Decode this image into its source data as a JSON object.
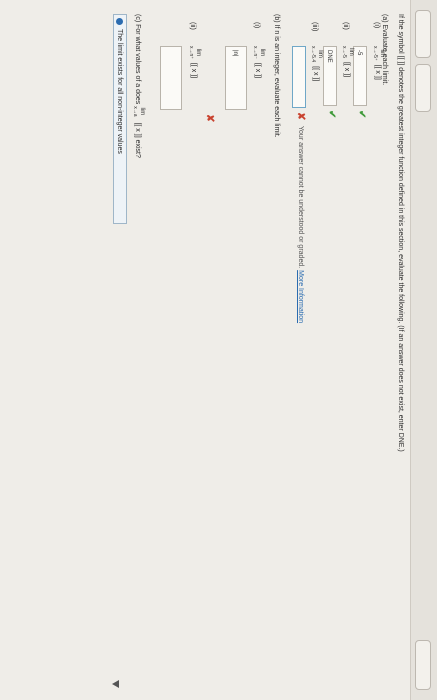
{
  "question": {
    "intro": "If the symbol [[ ]] denotes the greatest integer function defined in this section, evaluate the following. (If an answer does not exist, enter DNE.)"
  },
  "part_a": {
    "label": "(a)",
    "instruction": "Evaluate each limit.",
    "items": [
      {
        "num": "(i)",
        "lim": "lim",
        "under": "x→-5⁺",
        "expr": "[[ x ]]",
        "answer": "-5",
        "status": "correct"
      },
      {
        "num": "(ii)",
        "lim": "lim",
        "under": "x→-5",
        "expr": "[[ x ]]",
        "answer": "DNE",
        "status": "correct"
      },
      {
        "num": "(iii)",
        "lim": "lim",
        "under": "x→-5.4",
        "expr": "[[ x ]]",
        "answer": "",
        "status": "error"
      }
    ],
    "error_msg": "Your answer cannot be understood or graded.",
    "more_info": "More Information"
  },
  "part_b": {
    "label": "(b)",
    "instruction": "If n is an integer, evaluate each limit.",
    "items": [
      {
        "num": "(i)",
        "lim": "lim",
        "under": "x→n⁻",
        "expr": "[[ x ]]",
        "answer": "|n|",
        "status": "incorrect"
      },
      {
        "num": "(ii)",
        "lim": "lim",
        "under": "x→n⁺",
        "expr": "[[ x ]]",
        "answer": "",
        "status": "none"
      }
    ]
  },
  "part_c": {
    "label": "(c)",
    "prompt_pre": "For what values of a does",
    "lim": "lim",
    "under": "x→a",
    "expr": "[[ x ]]",
    "prompt_post": "exist?",
    "selected_option": "The limit exists for all non-integer values"
  },
  "colors": {
    "correct": "#3f9a3a",
    "incorrect": "#c9432f",
    "link": "#2b6cb0"
  }
}
